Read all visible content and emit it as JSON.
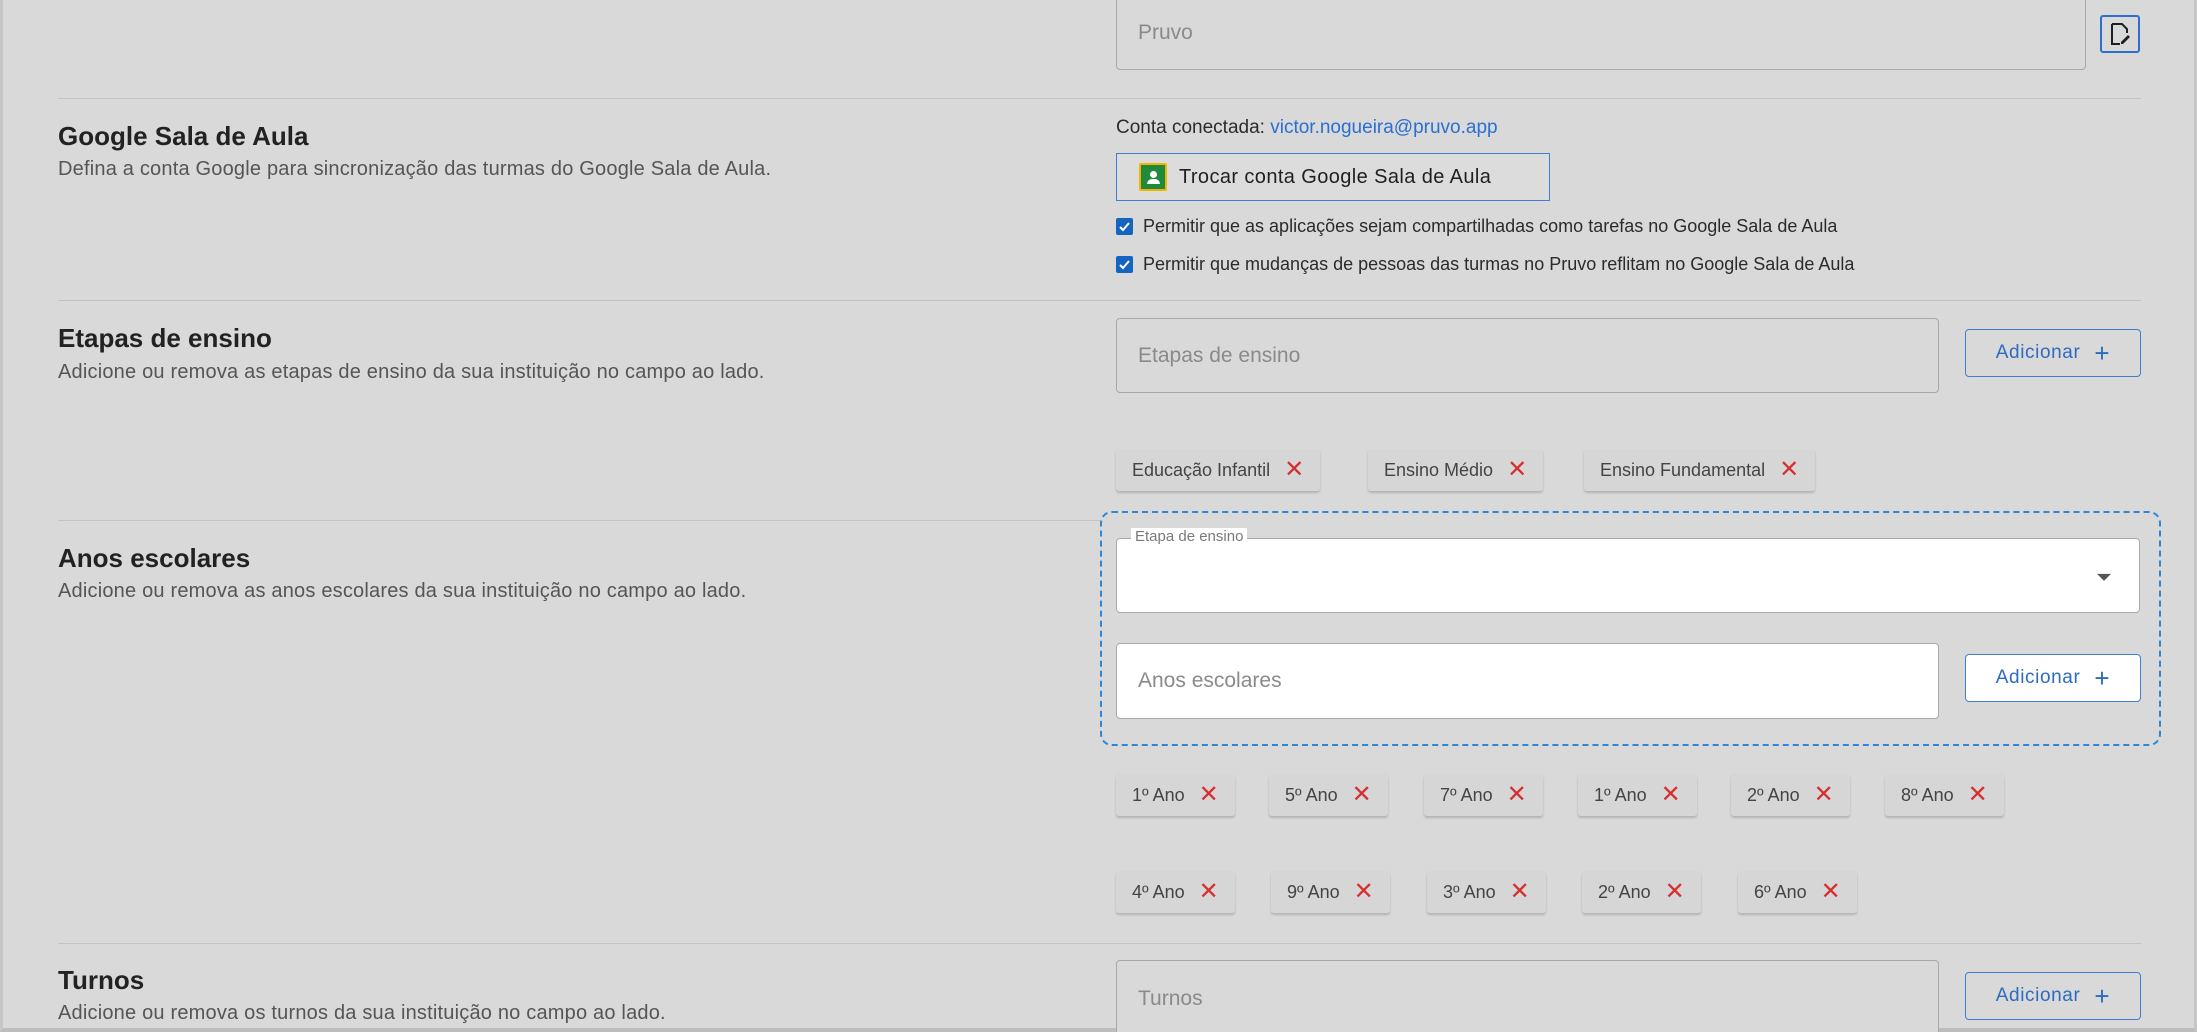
{
  "top_field": {
    "value": "Pruvo"
  },
  "google": {
    "title": "Google Sala de Aula",
    "description": "Defina a conta Google para sincronização das turmas do Google Sala de Aula.",
    "connected_label": "Conta conectada:",
    "connected_email": "victor.nogueira@pruvo.app",
    "switch_button": "Trocar conta Google Sala de Aula",
    "checkbox1": "Permitir que as aplicações sejam compartilhadas como tarefas no Google Sala de Aula",
    "checkbox2": "Permitir que mudanças de pessoas das turmas no Pruvo reflitam no Google Sala de Aula"
  },
  "etapas": {
    "title": "Etapas de ensino",
    "description": "Adicione ou remova as etapas de ensino da sua instituição no campo ao lado.",
    "placeholder": "Etapas de ensino",
    "add_label": "Adicionar",
    "chips": [
      "Educação Infantil",
      "Ensino Médio",
      "Ensino Fundamental"
    ]
  },
  "anos": {
    "title": "Anos escolares",
    "description": "Adicione ou remova as anos escolares da sua instituição no campo ao lado.",
    "select_label": "Etapa de ensino",
    "placeholder": "Anos escolares",
    "add_label": "Adicionar",
    "chips_row1": [
      "1º Ano",
      "5º Ano",
      "7º Ano",
      "1º Ano",
      "2º Ano",
      "8º Ano"
    ],
    "chips_row2": [
      "4º Ano",
      "9º Ano",
      "3º Ano",
      "2º Ano",
      "6º Ano"
    ]
  },
  "turnos": {
    "title": "Turnos",
    "description": "Adicione ou remova os turnos da sua instituição no campo ao lado.",
    "placeholder": "Turnos",
    "add_label": "Adicionar"
  },
  "icons": {
    "remove": "close-icon",
    "add": "plus-icon",
    "doc": "document-edit-icon"
  },
  "colors": {
    "accent": "#2e6bbf",
    "remove": "#d62f2f",
    "checkbox": "#1565c0"
  }
}
